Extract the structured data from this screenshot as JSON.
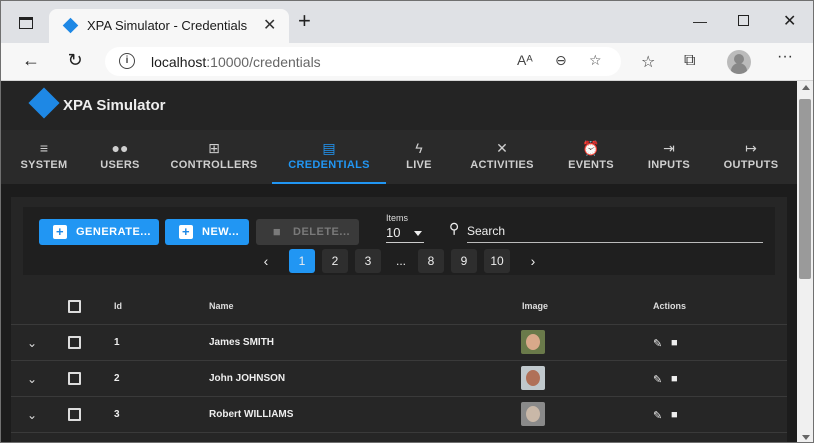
{
  "browser": {
    "tab_title": "XPA Simulator - Credentials",
    "url_host": "localhost",
    "url_path": ":10000/credentials"
  },
  "app": {
    "title": "XPA Simulator",
    "accent_color": "#2196f3"
  },
  "nav": {
    "tabs": [
      {
        "label": "SYSTEM",
        "icon": "database-icon",
        "active": false
      },
      {
        "label": "USERS",
        "icon": "users-icon",
        "active": false
      },
      {
        "label": "CONTROLLERS",
        "icon": "controller-icon",
        "active": false
      },
      {
        "label": "CREDENTIALS",
        "icon": "id-card-icon",
        "active": true
      },
      {
        "label": "LIVE",
        "icon": "bolt-icon",
        "active": false
      },
      {
        "label": "ACTIVITIES",
        "icon": "tools-icon",
        "active": false
      },
      {
        "label": "EVENTS",
        "icon": "alarm-icon",
        "active": false
      },
      {
        "label": "INPUTS",
        "icon": "login-icon",
        "active": false
      },
      {
        "label": "OUTPUTS",
        "icon": "logout-icon",
        "active": false
      }
    ]
  },
  "toolbar": {
    "generate_label": "GENERATE...",
    "new_label": "NEW...",
    "delete_label": "DELETE...",
    "items_label": "Items",
    "items_value": "10",
    "search_placeholder": "Search"
  },
  "pager": {
    "pages": [
      "1",
      "2",
      "3",
      "...",
      "8",
      "9",
      "10"
    ],
    "current": "1"
  },
  "table": {
    "headers": {
      "id": "Id",
      "name": "Name",
      "image": "Image",
      "actions": "Actions"
    },
    "rows": [
      {
        "id": "1",
        "name": "James SMITH"
      },
      {
        "id": "2",
        "name": "John JOHNSON"
      },
      {
        "id": "3",
        "name": "Robert WILLIAMS"
      }
    ]
  }
}
